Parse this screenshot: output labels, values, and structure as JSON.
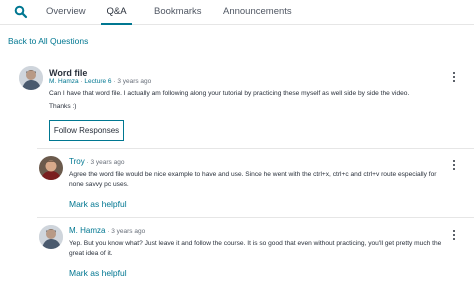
{
  "nav": {
    "tabs": [
      {
        "label": "Overview"
      },
      {
        "label": "Q&A"
      },
      {
        "label": "Bookmarks"
      },
      {
        "label": "Announcements"
      }
    ]
  },
  "back_link": "Back to All Questions",
  "question": {
    "title": "Word file",
    "author": "M. Hamza",
    "separator": "·",
    "lecture": "Lecture 6",
    "time_ago": "· 3 years ago",
    "body_1": "Can I have that word file. I actually am following along your tutorial by practicing these myself as well side by side the video.",
    "body_2": "Thanks :)",
    "follow_label": "Follow Responses"
  },
  "responses": [
    {
      "author": "Troy",
      "time_ago": "· 3 years ago",
      "body": "Agree the word file would be nice example to have and use. Since he went with the ctrl+x, ctrl+c and ctrl+v route especially for none savvy pc uses.",
      "helpful_label": "Mark as helpful"
    },
    {
      "author": "M. Hamza",
      "time_ago": "· 3 years ago",
      "body": "Yep. But you know what? Just leave it and follow the course. It is so good that even without practicing, you'll get pretty much the great idea of it.",
      "helpful_label": "Mark as helpful"
    }
  ],
  "colors": {
    "accent": "#007791",
    "text": "#29303b",
    "muted": "#686f7a"
  },
  "icons": {
    "search": "search-icon",
    "menu": "more-options-icon"
  }
}
